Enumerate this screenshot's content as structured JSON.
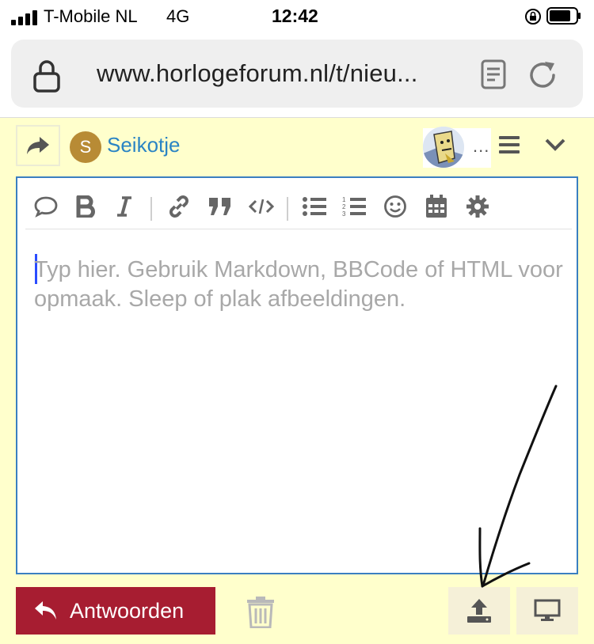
{
  "status_bar": {
    "carrier": "T-Mobile NL",
    "network": "4G",
    "time": "12:42",
    "icons": [
      "signal-icon",
      "orientation-lock-icon",
      "battery-icon"
    ]
  },
  "browser": {
    "url": "www.horlogeforum.nl/t/nieu...",
    "icons": [
      "lock-icon",
      "reader-mode-icon",
      "reload-icon"
    ]
  },
  "composer": {
    "user_initial": "S",
    "username": "Seikotje",
    "more": "...",
    "toolbar_icons": [
      "quote-icon",
      "bold-icon",
      "italic-icon",
      "link-icon",
      "blockquote-icon",
      "code-icon",
      "bullet-list-icon",
      "numbered-list-icon",
      "emoji-icon",
      "calendar-icon",
      "settings-gear-icon"
    ],
    "placeholder": "Typ hier. Gebruik Markdown, BBCode of HTML voor opmaak. Sleep of plak afbeeldingen."
  },
  "footer": {
    "reply_label": "Antwoorden",
    "icons": [
      "trash-icon",
      "upload-icon",
      "desktop-preview-icon"
    ]
  },
  "colors": {
    "background": "#ffffcc",
    "link": "#2a84c4",
    "reply_button": "#a71d31",
    "editor_border": "#3a7fc1"
  }
}
